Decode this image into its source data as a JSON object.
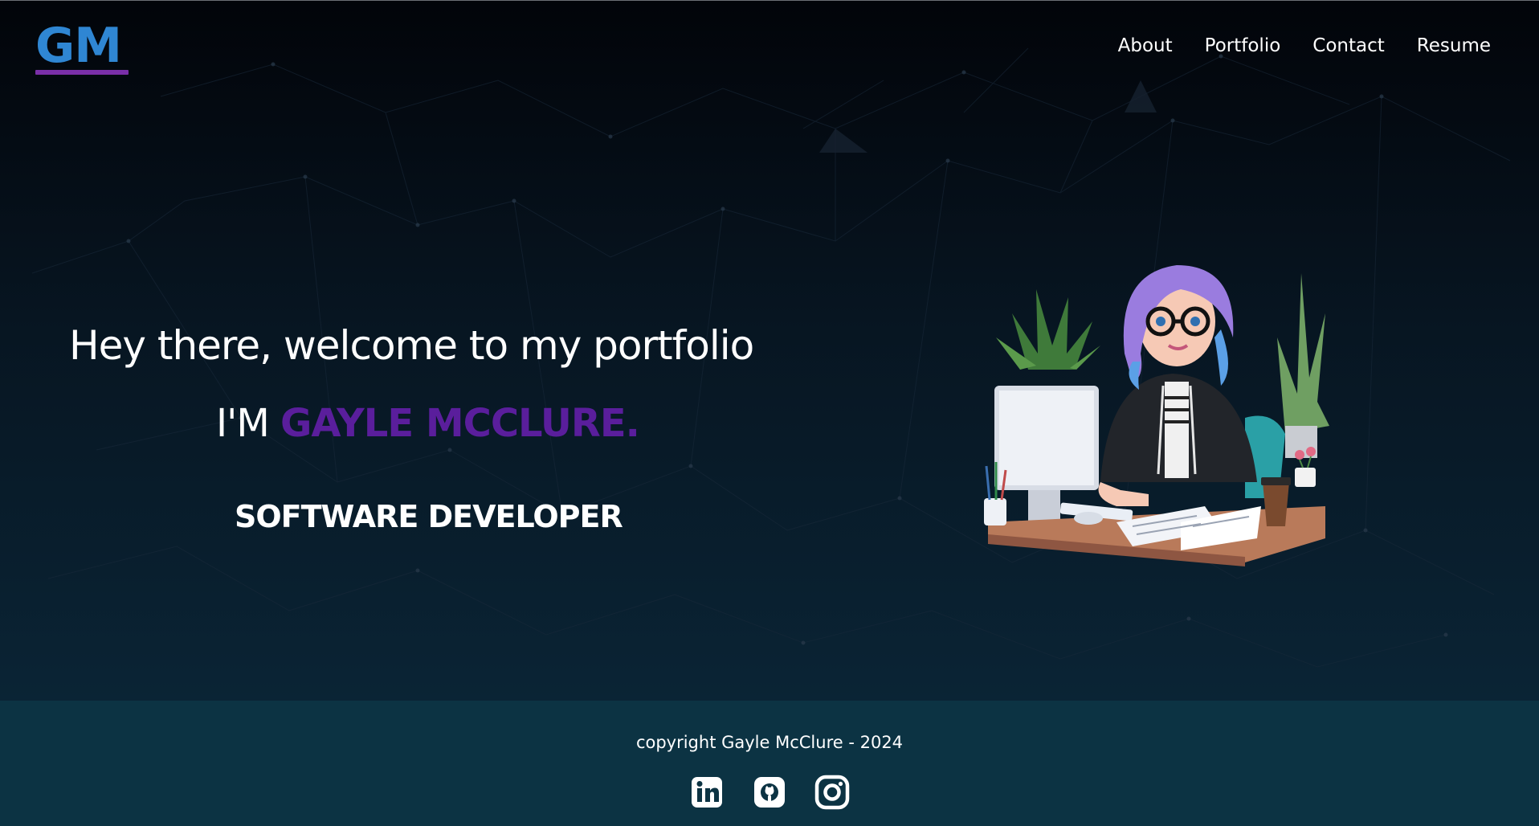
{
  "header": {
    "logo_text": "GM",
    "nav": [
      {
        "label": "About"
      },
      {
        "label": "Portfolio"
      },
      {
        "label": "Contact"
      },
      {
        "label": "Resume"
      }
    ]
  },
  "hero": {
    "headline": "Hey there, welcome to my portfolio",
    "intro_prefix": "I'M ",
    "intro_name": "GAYLE MCCLURE.",
    "role": "SOFTWARE DEVELOPER",
    "illustration_description": "developer-at-desk-illustration"
  },
  "footer": {
    "copyright": "copyright Gayle McClure - 2024",
    "socials": [
      {
        "icon": "linkedin-icon"
      },
      {
        "icon": "github-icon"
      },
      {
        "icon": "instagram-icon"
      }
    ]
  },
  "colors": {
    "logo_blue": "#2f86d3",
    "logo_underline": "#7a2fa8",
    "name_purple": "#5a1e9c",
    "footer_bg": "#0c3343",
    "hero_bg_top": "#020409",
    "hero_bg_bottom": "#0a2435"
  }
}
